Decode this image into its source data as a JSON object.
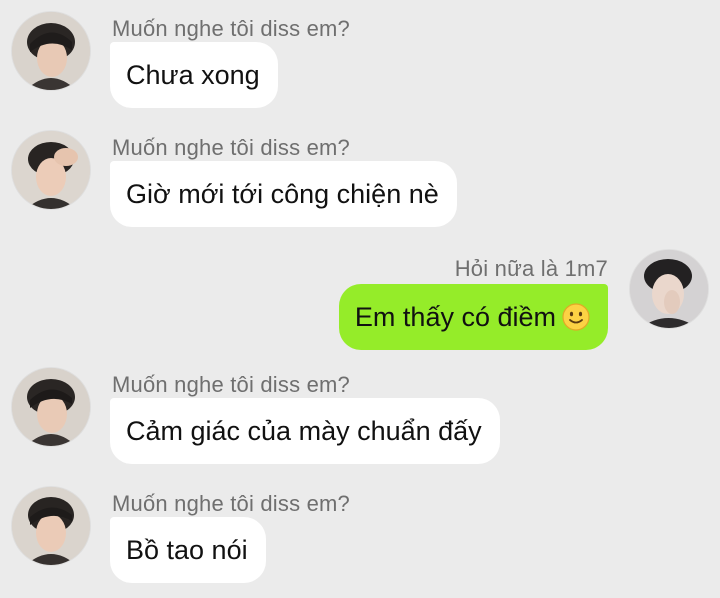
{
  "messages": [
    {
      "direction": "in",
      "sender": "Muốn nghe tôi diss em?",
      "text": "Chưa xong"
    },
    {
      "direction": "in",
      "sender": "Muốn nghe tôi diss em?",
      "text": "Giờ mới tới công chiện nè"
    },
    {
      "direction": "out",
      "sender": "Hỏi nữa là 1m7",
      "text": "Em thấy có điềm",
      "emoji": "smile-emoji"
    },
    {
      "direction": "in",
      "sender": "Muốn nghe tôi diss em?",
      "text": "Cảm giác của mày chuẩn đấy"
    },
    {
      "direction": "in",
      "sender": "Muốn nghe tôi diss em?",
      "text": "Bồ tao nói"
    }
  ],
  "colors": {
    "background": "#ebebeb",
    "incoming_bubble": "#ffffff",
    "outgoing_bubble": "#95ec29",
    "sender_text": "#6f6f6f"
  }
}
